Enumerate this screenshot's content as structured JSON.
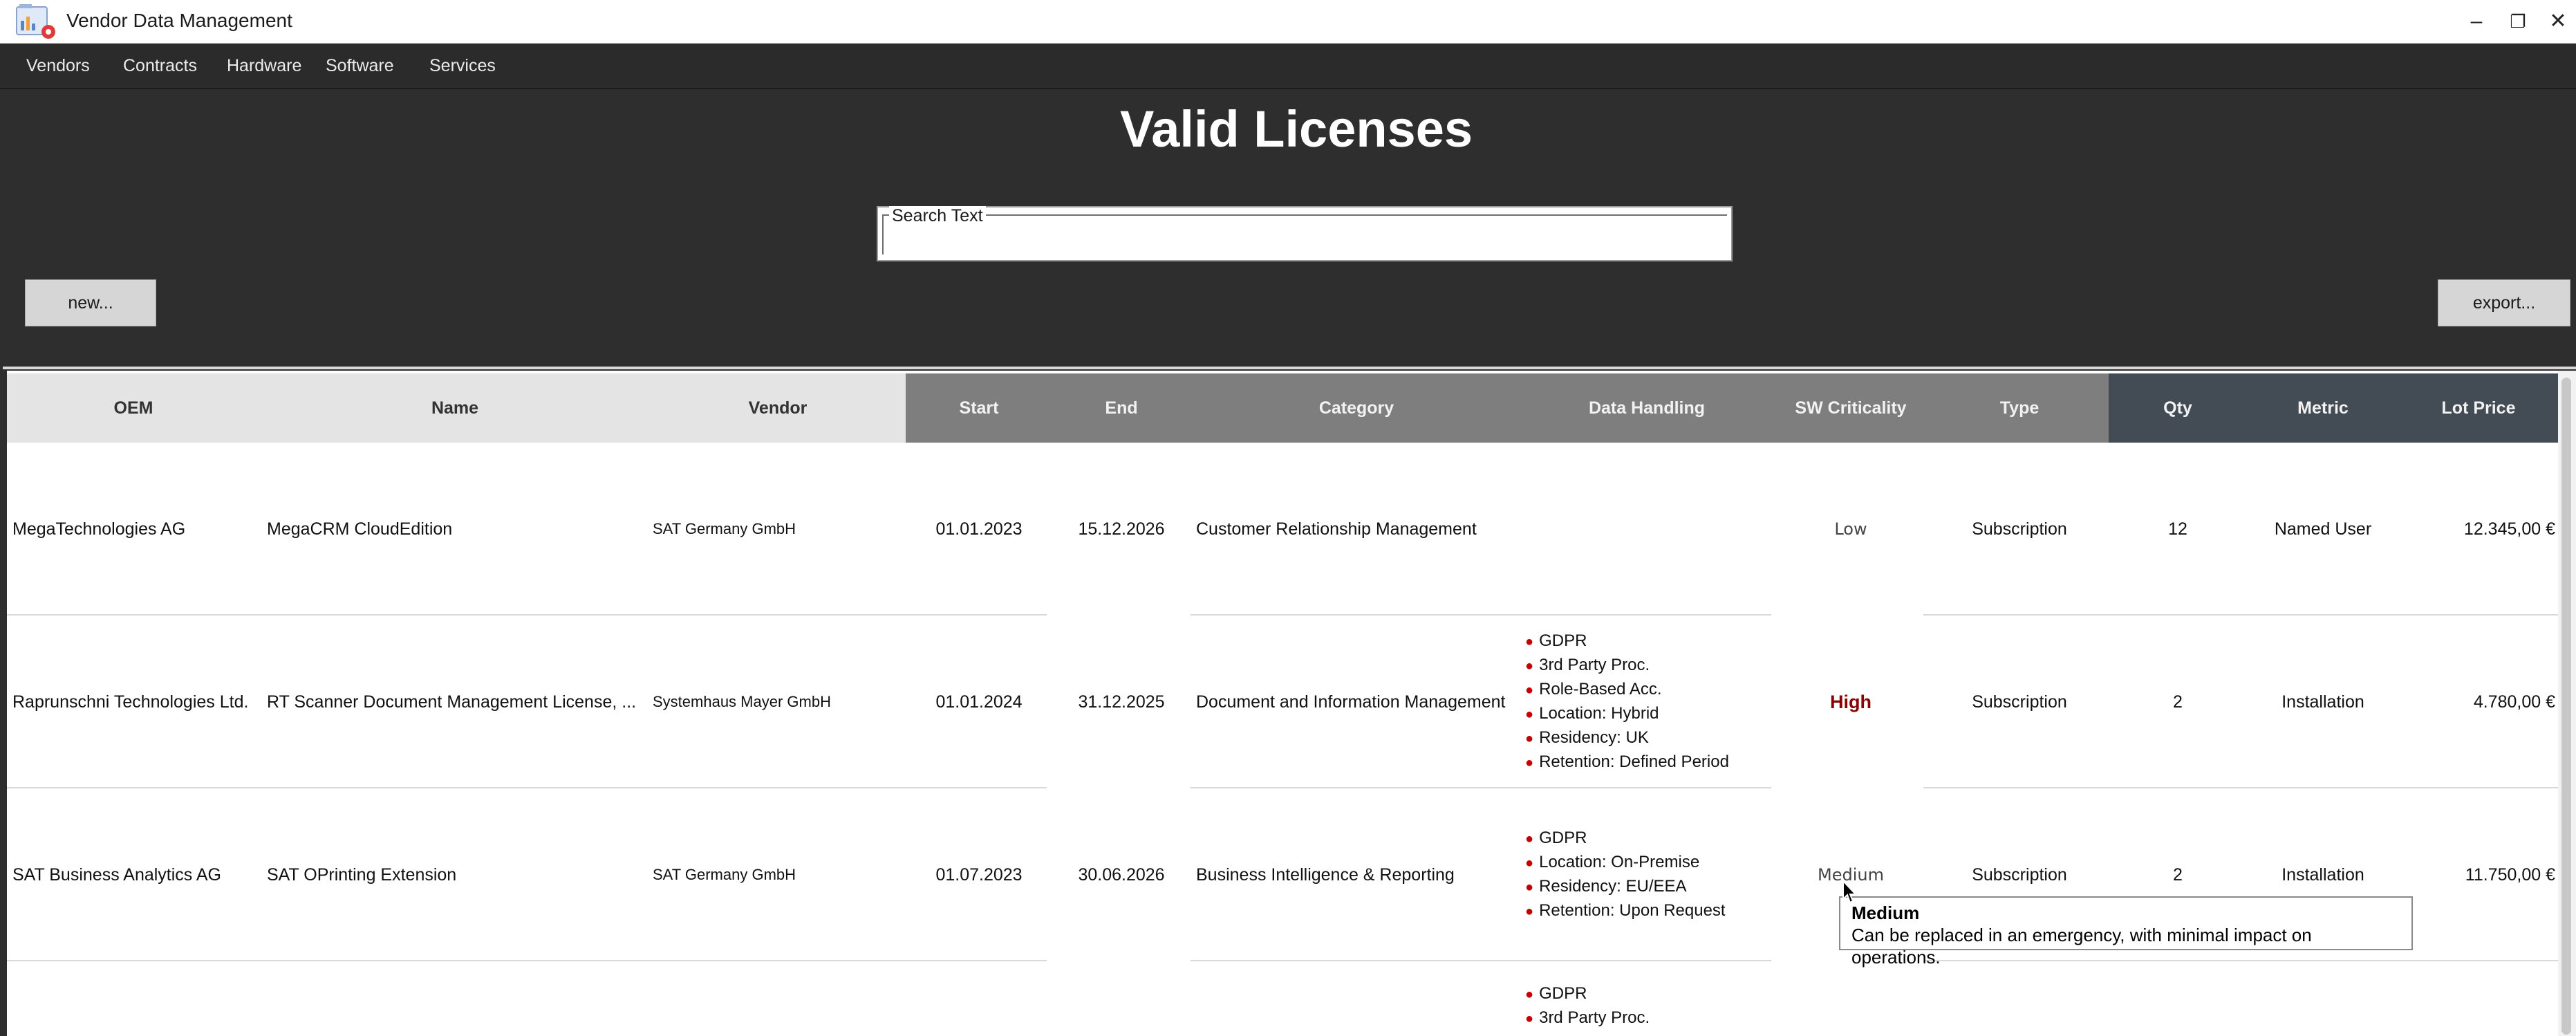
{
  "window": {
    "title": "Vendor Data Management",
    "icon": "app-icon"
  },
  "window_controls": {
    "minimize": "–",
    "restore": "❐",
    "close": "✕"
  },
  "menu": {
    "items": [
      "Vendors",
      "Contracts",
      "Hardware",
      "Software",
      "Services"
    ]
  },
  "page": {
    "title": "Valid Licenses"
  },
  "search": {
    "label": "Search Text",
    "value": ""
  },
  "buttons": {
    "new": "new...",
    "export": "export..."
  },
  "table": {
    "columns": [
      "OEM",
      "Name",
      "Vendor",
      "Start",
      "End",
      "Category",
      "Data Handling",
      "SW Criticality",
      "Type",
      "Qty",
      "Metric",
      "Lot Price"
    ],
    "column_group_colors": {
      "group1": "#e4e4e4",
      "group2": "#7e7e7e",
      "group3": "#434b54"
    },
    "rows": [
      {
        "oem": "MegaTechnologies AG",
        "name": "MegaCRM CloudEdition",
        "vendor": "SAT Germany GmbH",
        "start": "01.01.2023",
        "end": "15.12.2026",
        "category": "Customer Relationship Management",
        "data_handling": [],
        "criticality": "Low",
        "type": "Subscription",
        "qty": "12",
        "metric": "Named User",
        "lot_price": "12.345,00 €"
      },
      {
        "oem": "Raprunschni Technologies Ltd.",
        "name": "RT Scanner Document Management License, ...",
        "vendor": "Systemhaus Mayer GmbH",
        "start": "01.01.2024",
        "end": "31.12.2025",
        "category": "Document and Information Management",
        "data_handling": [
          "GDPR",
          "3rd Party Proc.",
          "Role-Based Acc.",
          "Location: Hybrid",
          "Residency: UK",
          "Retention: Defined Period"
        ],
        "criticality": "High",
        "type": "Subscription",
        "qty": "2",
        "metric": "Installation",
        "lot_price": "4.780,00 €"
      },
      {
        "oem": "SAT Business Analytics AG",
        "name": "SAT OPrinting Extension",
        "vendor": "SAT Germany GmbH",
        "start": "01.07.2023",
        "end": "30.06.2026",
        "category": "Business Intelligence & Reporting",
        "data_handling": [
          "GDPR",
          "Location: On-Premise",
          "Residency: EU/EEA",
          "Retention: Upon Request"
        ],
        "criticality": "Medium",
        "type": "Subscription",
        "qty": "2",
        "metric": "Installation",
        "lot_price": "11.750,00 €"
      },
      {
        "oem": "",
        "name": "",
        "vendor": "",
        "start": "",
        "end": "",
        "category": "",
        "data_handling": [
          "GDPR",
          "3rd Party Proc."
        ],
        "criticality": "",
        "type": "",
        "qty": "",
        "metric": "",
        "lot_price": ""
      }
    ]
  },
  "tooltip": {
    "title": "Medium",
    "body": "Can be replaced in an emergency, with minimal impact on operations."
  },
  "colors": {
    "criticality_high": "#8b0000",
    "bullet": "#c40000",
    "background": "#2e2e2e"
  }
}
